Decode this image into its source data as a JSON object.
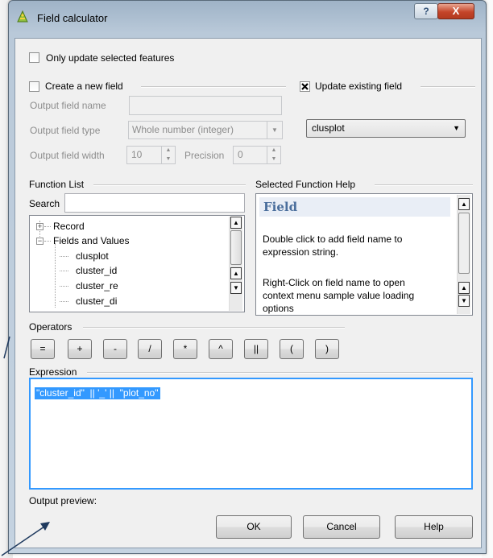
{
  "window": {
    "title": "Field calculator",
    "help_glyph": "?",
    "close_glyph": "X"
  },
  "only_update_selected": {
    "label": "Only update selected features",
    "checked": false
  },
  "create_new_field": {
    "label": "Create a new field",
    "checked": false,
    "output_field_name_label": "Output field name",
    "output_field_name_value": "",
    "output_field_type_label": "Output field type",
    "output_field_type_value": "Whole number (integer)",
    "output_field_width_label": "Output field width",
    "output_field_width_value": "10",
    "precision_label": "Precision",
    "precision_value": "0"
  },
  "update_existing_field": {
    "label": "Update existing field",
    "checked": true,
    "selected": "clusplot"
  },
  "function_list": {
    "label": "Function List",
    "search_label": "Search",
    "search_value": "",
    "items": [
      {
        "label": "Record",
        "expander": "+"
      },
      {
        "label": "Fields and Values",
        "expander": "−"
      },
      {
        "label": "clusplot"
      },
      {
        "label": "cluster_id"
      },
      {
        "label": "cluster_re"
      },
      {
        "label": "cluster_di"
      }
    ]
  },
  "function_help": {
    "label": "Selected Function Help",
    "heading": "Field",
    "paragraph1": "Double click to add field name to expression string.",
    "paragraph2_line1": "Right-Click on field name to open",
    "paragraph2_line2": "context menu sample value loading",
    "paragraph2_line3": "options"
  },
  "operators": {
    "label": "Operators",
    "buttons": [
      "=",
      "+",
      "-",
      "/",
      "*",
      "^",
      "||",
      "(",
      ")"
    ]
  },
  "expression": {
    "label": "Expression",
    "value": "\"cluster_id\"  || '_' ||  \"plot_no\""
  },
  "output_preview": {
    "label": "Output preview:"
  },
  "buttons": {
    "ok": "OK",
    "cancel": "Cancel",
    "help": "Help"
  },
  "colors": {
    "selection": "#3399ff",
    "help_heading": "#4a6e9c",
    "help_heading_bg": "#e9eef6",
    "titlebar": "#b9c9d9",
    "close_button": "#c4452a"
  }
}
